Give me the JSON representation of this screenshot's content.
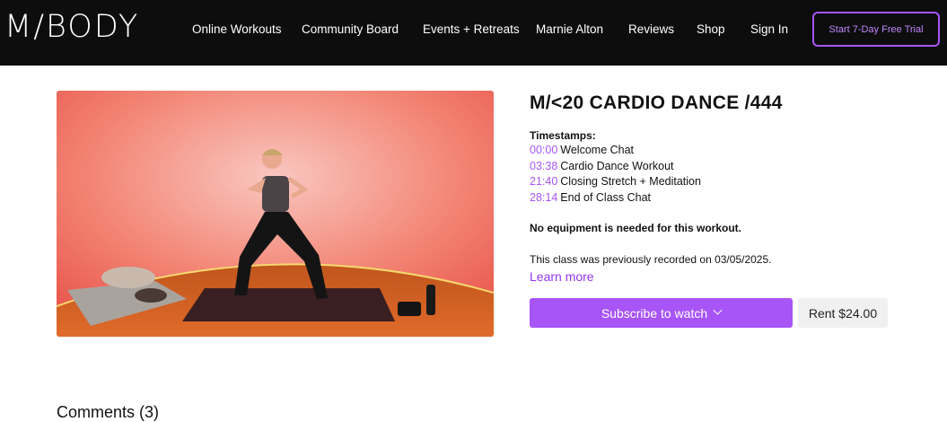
{
  "nav": {
    "logo": "M/BODY",
    "links": [
      "Online Workouts",
      "Community Board",
      "Events + Retreats",
      "Marnie Alton",
      "Reviews",
      "Shop",
      "Sign In"
    ],
    "cta": "Start 7-Day Free Trial"
  },
  "workout": {
    "title": "M/<20 CARDIO DANCE /444",
    "timestamps_heading": "Timestamps:",
    "timestamps": [
      {
        "time": "00:00",
        "label": "Welcome Chat"
      },
      {
        "time": "03:38",
        "label": "Cardio Dance Workout"
      },
      {
        "time": "21:40",
        "label": "Closing Stretch + Meditation"
      },
      {
        "time": "28:14",
        "label": "End of Class Chat"
      }
    ],
    "equipment": "No equipment is needed for this workout.",
    "recorded": "This class was previously recorded on 03/05/2025.",
    "learn_more": "Learn more",
    "subscribe": "Subscribe to watch",
    "rent": "Rent $24.00"
  },
  "comments": {
    "label": "Comments (3)"
  },
  "colors": {
    "accent": "#a855f7",
    "nav_bg": "#0d0d0d"
  },
  "icons": {
    "dropdown": "chevron-down-icon"
  }
}
